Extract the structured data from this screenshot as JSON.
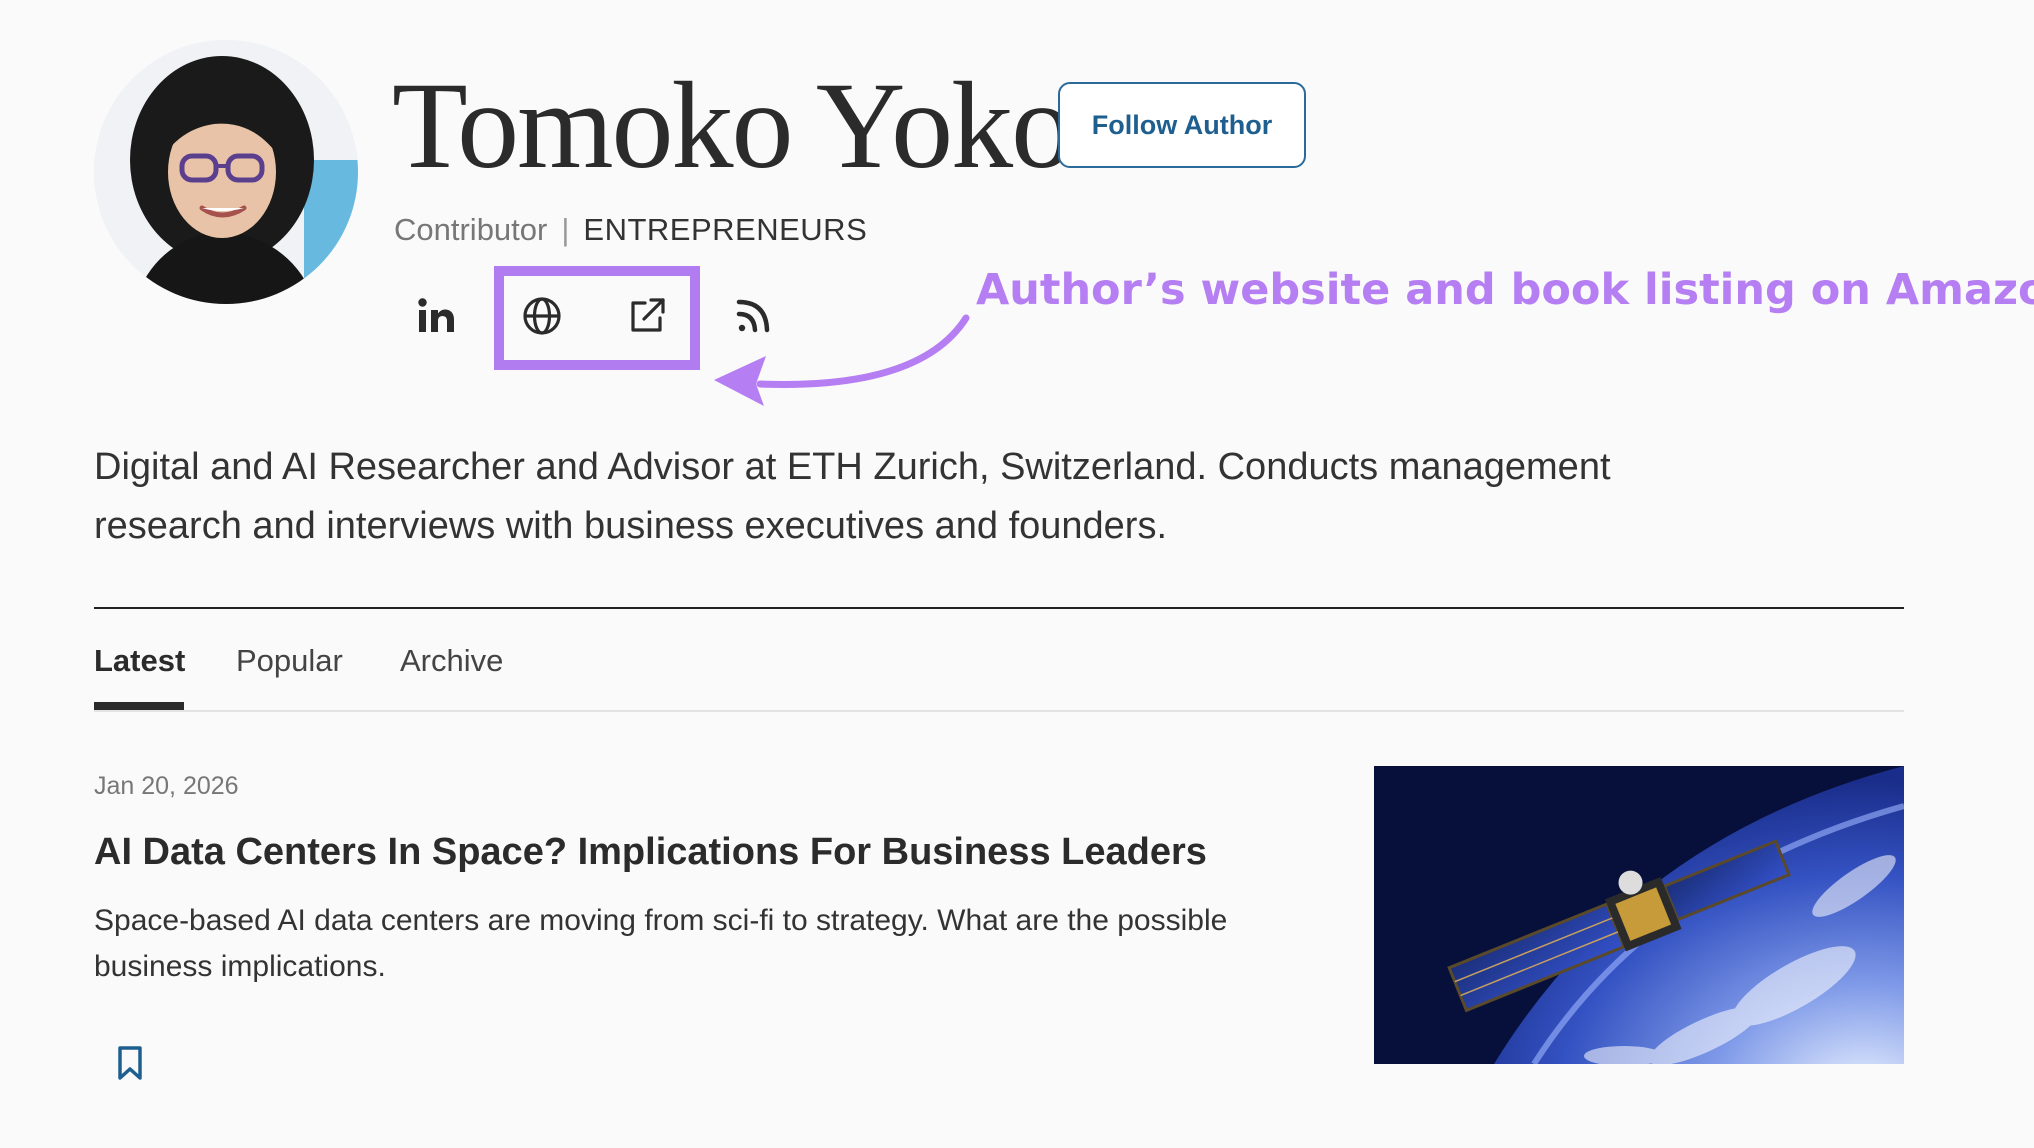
{
  "author": {
    "name": "Tomoko Yokoi",
    "follow_label": "Follow Author",
    "role": "Contributor",
    "separator": "|",
    "section": "ENTREPRENEURS",
    "bio": "Digital and AI Researcher and Advisor at ETH Zurich, Switzerland. Conducts management research and interviews with business executives and founders."
  },
  "social": [
    {
      "icon": "linkedin-icon"
    },
    {
      "icon": "globe-icon"
    },
    {
      "icon": "external-link-icon"
    },
    {
      "icon": "rss-icon"
    }
  ],
  "annotation": {
    "text": "Author’s website and book listing on Amazon",
    "color": "#b57ef2"
  },
  "tabs": [
    {
      "label": "Latest",
      "active": true
    },
    {
      "label": "Popular",
      "active": false
    },
    {
      "label": "Archive",
      "active": false
    }
  ],
  "article": {
    "date": "Jan 20, 2026",
    "title": "AI Data Centers In Space? Implications For Business Leaders",
    "summary": "Space-based AI data centers are moving from sci-fi to strategy. What are the possible business implications.",
    "bookmark_icon": "bookmark-icon"
  },
  "colors": {
    "accent": "#1f5f8f",
    "highlight": "#b07cf0",
    "text": "#333333"
  }
}
